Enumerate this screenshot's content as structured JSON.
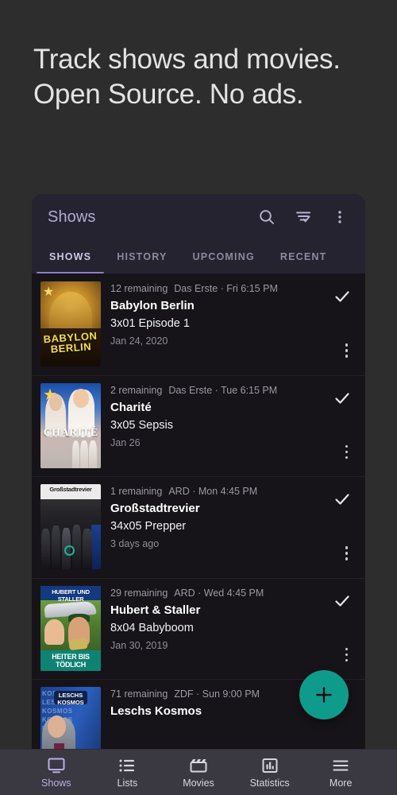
{
  "hero": {
    "headline": "Track shows and movies. Open Source. No ads."
  },
  "colors": {
    "page_background": "#2d2d2d",
    "appbar_background": "#252330",
    "list_background": "#161419",
    "accent_purple": "#8b7fc4",
    "title_purple": "#b3a9d6",
    "fab_teal": "#0f9b8c",
    "bottomnav_background": "#3a3840"
  },
  "appbar": {
    "title": "Shows",
    "actions": [
      {
        "name": "search-icon",
        "label": "Search"
      },
      {
        "name": "filter-icon",
        "label": "Filter"
      },
      {
        "name": "overflow-menu-icon",
        "label": "More options"
      }
    ]
  },
  "tabs": [
    {
      "label": "SHOWS",
      "active": true
    },
    {
      "label": "HISTORY",
      "active": false
    },
    {
      "label": "UPCOMING",
      "active": false
    },
    {
      "label": "RECENT",
      "active": false
    }
  ],
  "shows": [
    {
      "remaining": "12 remaining",
      "network": "Das Erste · Fri 6:15 PM",
      "title": "Babylon Berlin",
      "episode": "3x01 Episode 1",
      "date": "Jan 24, 2020",
      "poster_text": "BABYLON BERLIN"
    },
    {
      "remaining": "2 remaining",
      "network": "Das Erste · Tue 6:15 PM",
      "title": "Charité",
      "episode": "3x05 Sepsis",
      "date": "Jan 26",
      "poster_text": "CHARITÉ"
    },
    {
      "remaining": "1 remaining",
      "network": "ARD · Mon 4:45 PM",
      "title": "Großstadtrevier",
      "episode": "34x05 Prepper",
      "date": "3 days ago",
      "poster_text": "Großstadtrevier"
    },
    {
      "remaining": "29 remaining",
      "network": "ARD · Wed 4:45 PM",
      "title": "Hubert & Staller",
      "episode": "8x04 Babyboom",
      "date": "Jan 30, 2019",
      "poster_text": "HUBERT UND STALLER",
      "poster_text_bottom": "HEITER BIS TÖDLICH"
    },
    {
      "remaining": "71 remaining",
      "network": "ZDF · Sun 9:00 PM",
      "title": "Leschs Kosmos",
      "episode": "",
      "date": "",
      "poster_text": "LESCHS KOSMOS"
    }
  ],
  "fab": {
    "label": "+",
    "name": "add-button"
  },
  "bottom_nav": [
    {
      "label": "Shows",
      "icon": "tv-icon",
      "active": true
    },
    {
      "label": "Lists",
      "icon": "list-icon",
      "active": false
    },
    {
      "label": "Movies",
      "icon": "clapperboard-icon",
      "active": false
    },
    {
      "label": "Statistics",
      "icon": "bar-chart-icon",
      "active": false
    },
    {
      "label": "More",
      "icon": "hamburger-icon",
      "active": false
    }
  ]
}
